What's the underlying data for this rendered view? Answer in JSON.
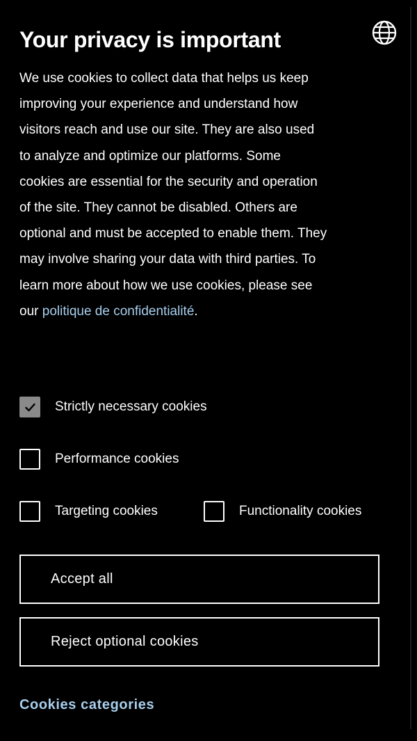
{
  "banner": {
    "title": "Your privacy is important",
    "language_icon": "globe-icon",
    "description": "We use cookies to collect data that helps us keep improving your experience and understand how visitors reach and use our site. They are also used to analyze and optimize our platforms. Some cookies are essential for the security and operation of the site. They cannot be disabled. Others are optional and must be accepted to enable them. They may involve sharing your data with third parties. To learn more about how we use cookies, please see our ",
    "privacy_link": "politique de confidentialité",
    "description_end": "."
  },
  "cookies": {
    "strictly_necessary": {
      "label": "Strictly necessary cookies",
      "checked": true,
      "disabled": true
    },
    "performance": {
      "label": "Performance cookies",
      "checked": false
    },
    "targeting": {
      "label": "Targeting cookies",
      "checked": false
    },
    "functionality": {
      "label": "Functionality cookies",
      "checked": false
    }
  },
  "buttons": {
    "accept_all": "Accept all",
    "reject_optional": "Reject optional cookies"
  },
  "footer": {
    "categories_link": "Cookies categories"
  },
  "colors": {
    "background": "#000000",
    "text": "#ffffff",
    "link": "#a8cfee",
    "disabled_checkbox": "#8a8a8a"
  }
}
